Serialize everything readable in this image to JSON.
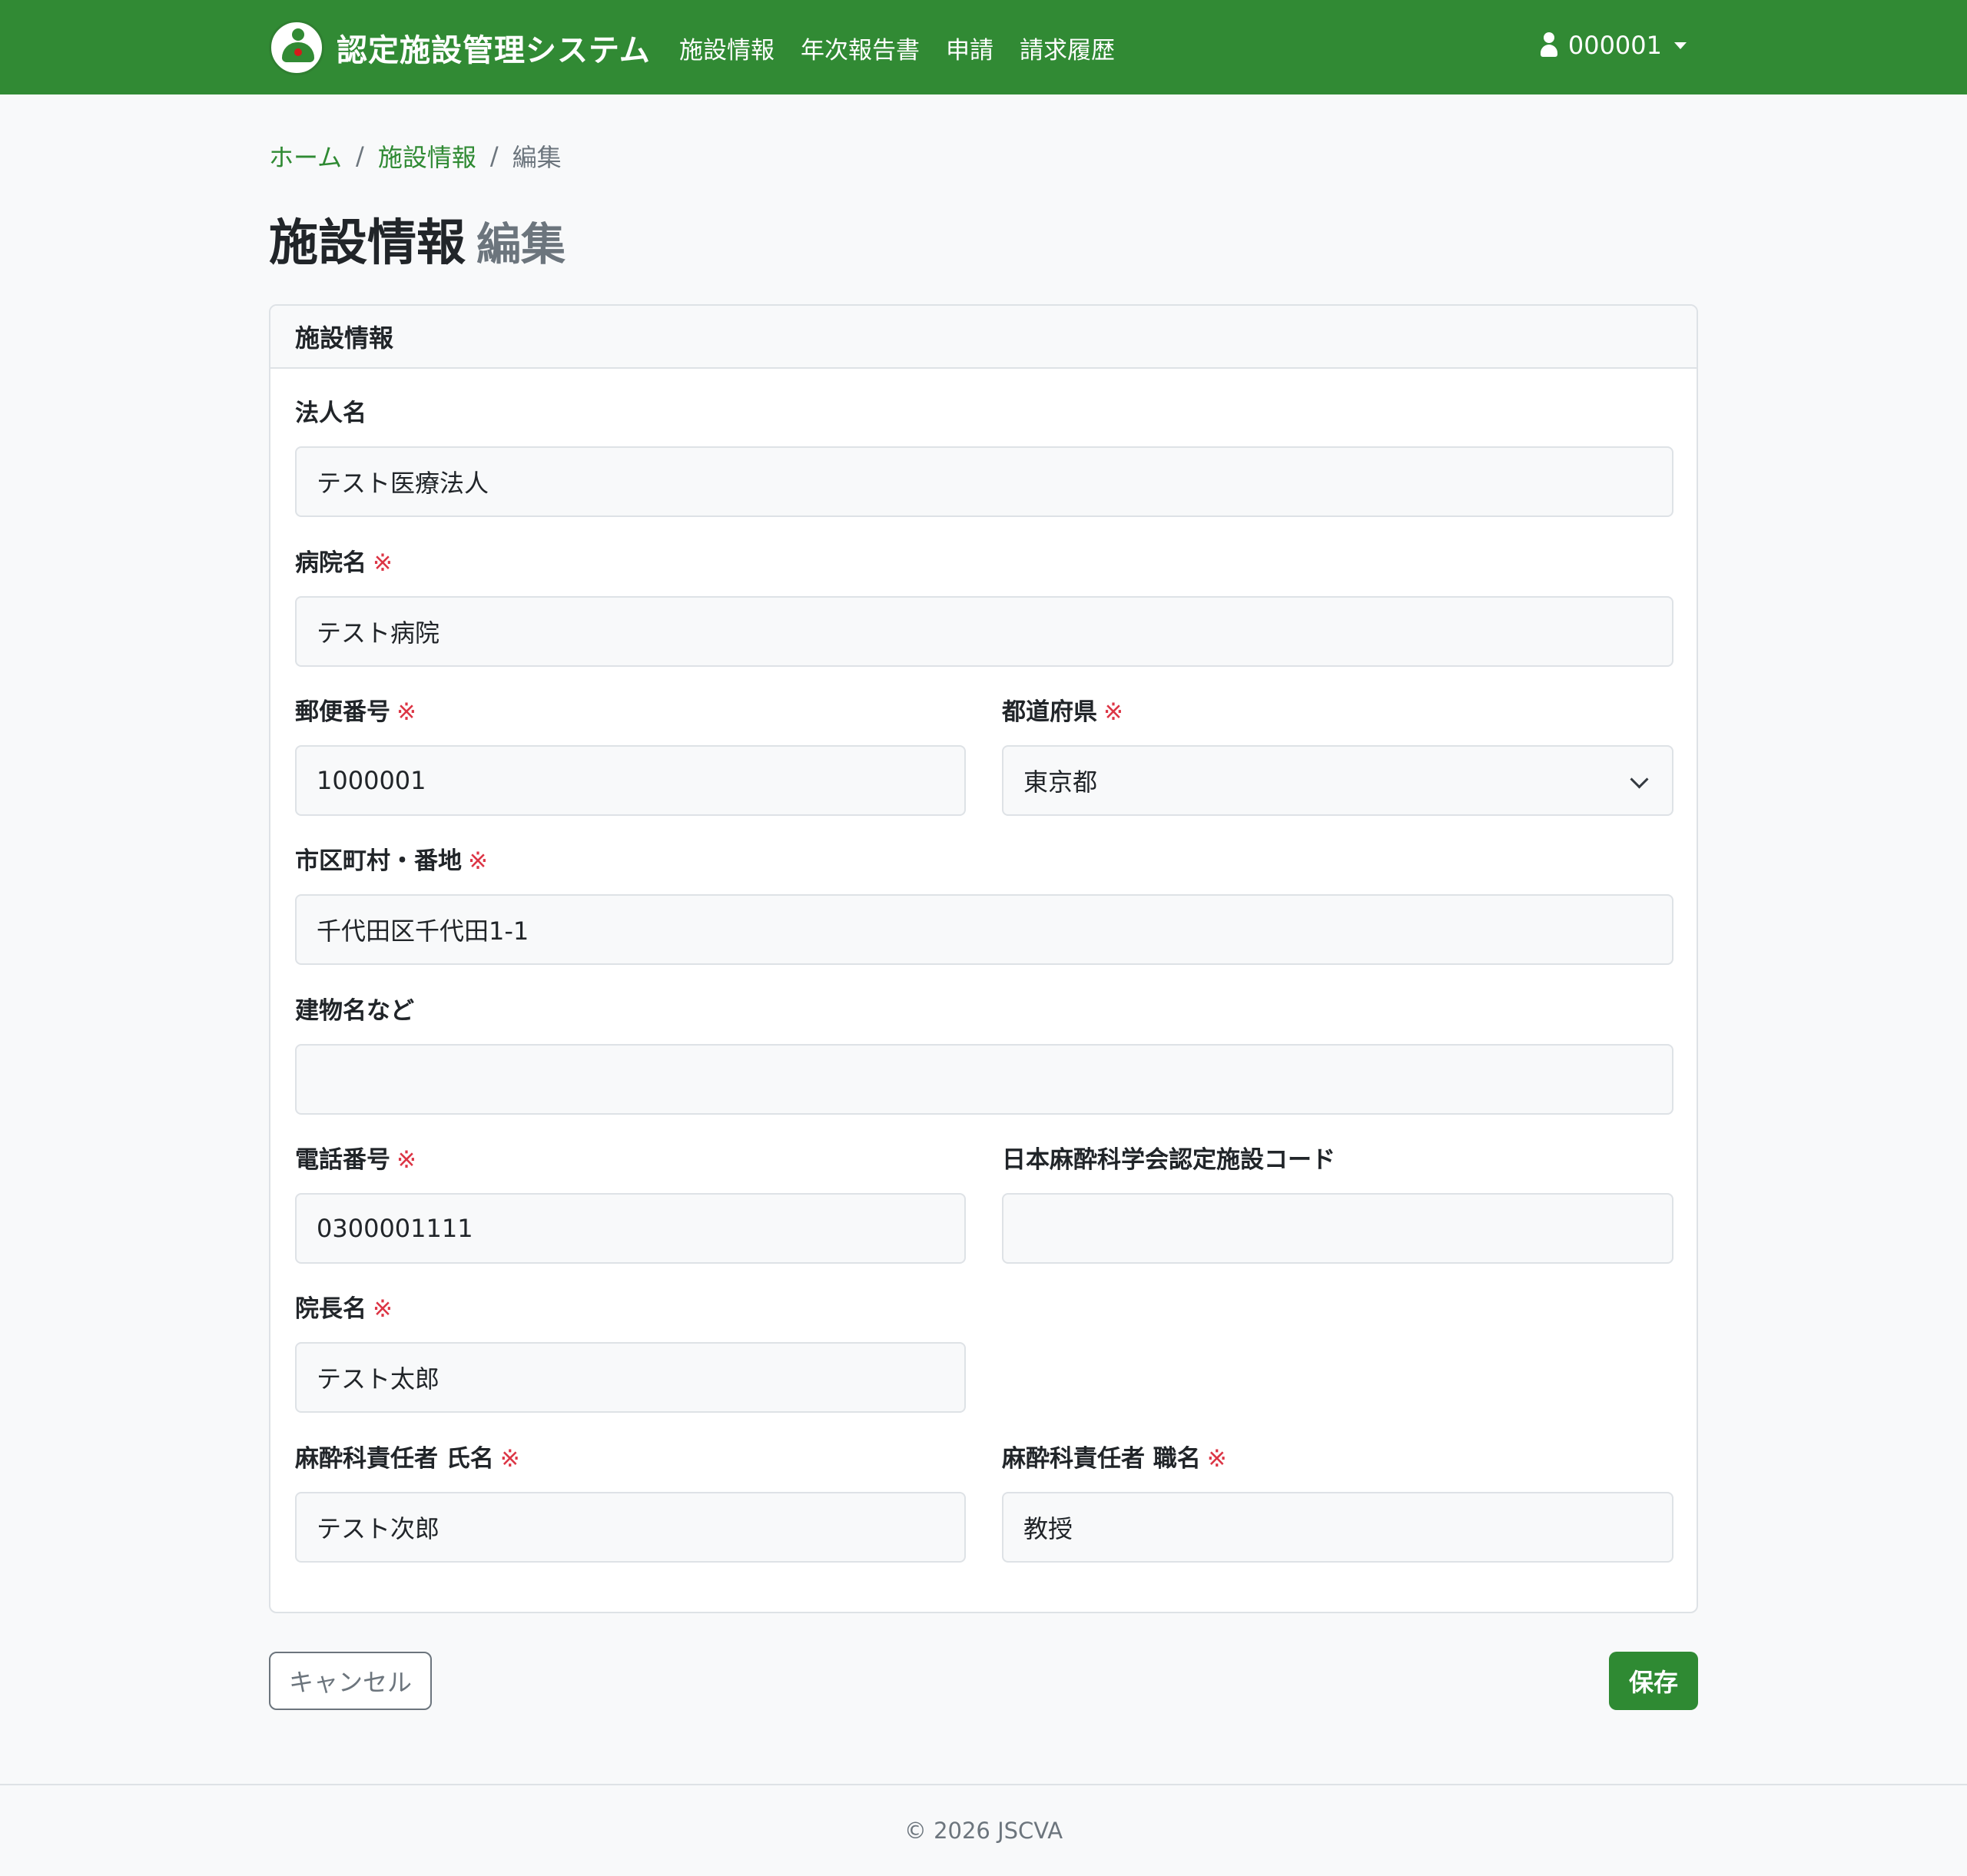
{
  "app": {
    "title": "認定施設管理システム",
    "brand_color": "#318a34"
  },
  "nav": {
    "items": [
      {
        "label": "施設情報"
      },
      {
        "label": "年次報告書"
      },
      {
        "label": "申請"
      },
      {
        "label": "請求履歴"
      }
    ],
    "user": {
      "id": "000001",
      "icon": "user-icon"
    }
  },
  "breadcrumb": {
    "home": "ホーム",
    "section": "施設情報",
    "current": "編集",
    "separator": "/"
  },
  "page": {
    "title": "施設情報",
    "subtitle": "編集"
  },
  "form": {
    "header": "施設情報",
    "required_mark": "※",
    "fields": {
      "corporation_name": {
        "label": "法人名",
        "value": "テスト医療法人"
      },
      "hospital_name": {
        "label": "病院名",
        "value": "テスト病院"
      },
      "postal_code": {
        "label": "郵便番号",
        "value": "1000001"
      },
      "prefecture": {
        "label": "都道府県",
        "value": "東京都"
      },
      "city_address": {
        "label": "市区町村・番地",
        "value": "千代田区千代田1-1"
      },
      "building": {
        "label": "建物名など",
        "value": ""
      },
      "phone": {
        "label": "電話番号",
        "value": "0300001111"
      },
      "jsa_code": {
        "label": "日本麻酔科学会認定施設コード",
        "value": ""
      },
      "director_name": {
        "label": "院長名",
        "value": "テスト太郎"
      },
      "anesth_chief_name": {
        "label": "麻酔科責任者 氏名",
        "value": "テスト次郎"
      },
      "anesth_chief_title": {
        "label": "麻酔科責任者 職名",
        "value": "教授"
      }
    }
  },
  "buttons": {
    "cancel": "キャンセル",
    "save": "保存"
  },
  "footer": {
    "text": "© 2026 JSCVA"
  }
}
